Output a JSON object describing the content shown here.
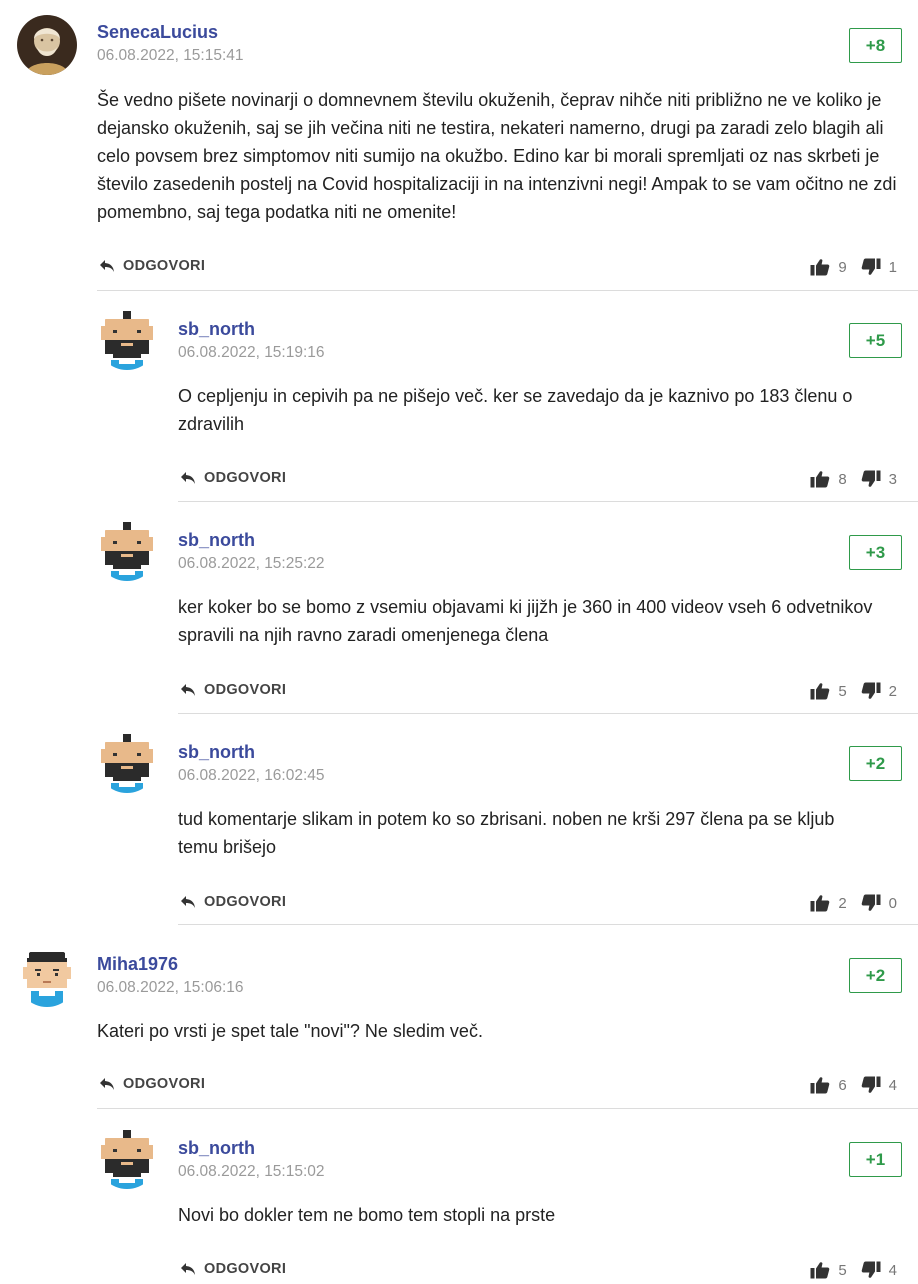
{
  "reply_label": "ODGOVORI",
  "colors": {
    "author": "#3b4a9c",
    "score": "#2f9a4a",
    "meta": "#9a9a9a"
  },
  "comments": [
    {
      "author": "SenecaLucius",
      "timestamp": "06.08.2022, 15:15:41",
      "score": "+8",
      "text": "Še vedno pišete novinarji o domnevnem številu okuženih, čeprav nihče niti približno ne ve koliko je dejansko okuženih, saj se jih večina niti ne testira, nekateri namerno, drugi pa zaradi zelo blagih ali celo povsem brez simptomov niti sumijo na okužbo. Edino kar bi morali spremljati oz nas skrbeti je število zasedenih postelj na Covid hospitalizaciji in na intenzivni negi! Ampak to se vam očitno ne zdi pomembno, saj tega podatka niti ne omenite!",
      "likes": "9",
      "dislikes": "1",
      "avatar": "bust-photo"
    },
    {
      "author": "sb_north",
      "timestamp": "06.08.2022, 15:19:16",
      "score": "+5",
      "text": "O cepljenju in cepivih pa ne pišejo več. ker se zavedajo da je kaznivo po 183 členu o zdravilih",
      "likes": "8",
      "dislikes": "3",
      "avatar": "pixel-bearded"
    },
    {
      "author": "sb_north",
      "timestamp": "06.08.2022, 15:25:22",
      "score": "+3",
      "text": "ker koker bo se bomo z vsemiu objavami ki jijžh je 360 in 400 videov vseh 6 odvetnikov spravili na njih ravno zaradi omenjenega člena",
      "likes": "5",
      "dislikes": "2",
      "avatar": "pixel-bearded"
    },
    {
      "author": "sb_north",
      "timestamp": "06.08.2022, 16:02:45",
      "score": "+2",
      "text": "tud komentarje slikam in potem ko so zbrisani. noben ne krši 297 člena pa se kljub temu brišejo",
      "likes": "2",
      "dislikes": "0",
      "avatar": "pixel-bearded"
    },
    {
      "author": "Miha1976",
      "timestamp": "06.08.2022, 15:06:16",
      "score": "+2",
      "text": "Kateri po vrsti je spet tale \"novi\"? Ne sledim več.",
      "likes": "6",
      "dislikes": "4",
      "avatar": "pixel-face"
    },
    {
      "author": "sb_north",
      "timestamp": "06.08.2022, 15:15:02",
      "score": "+1",
      "text": "Novi bo dokler tem ne bomo tem stopli na prste",
      "likes": "5",
      "dislikes": "4",
      "avatar": "pixel-bearded"
    }
  ]
}
